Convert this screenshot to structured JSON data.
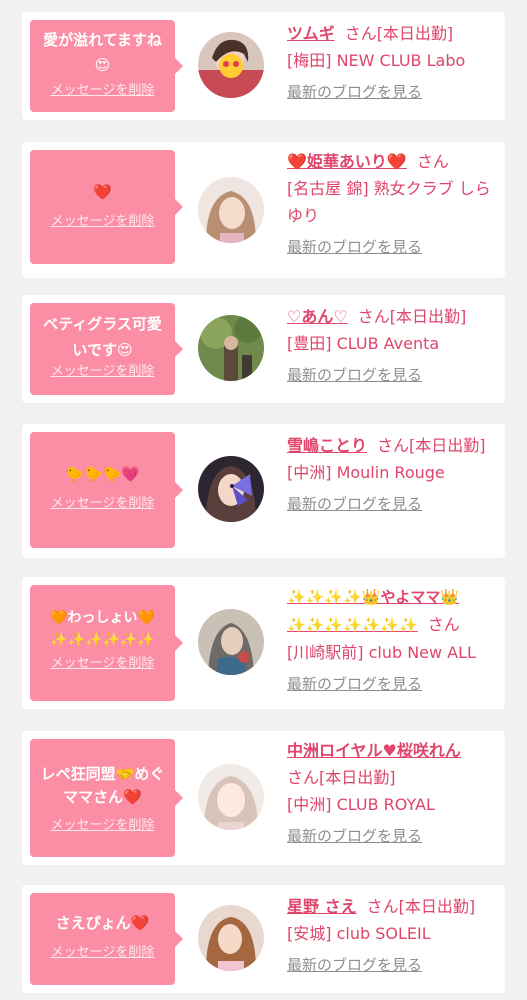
{
  "cards": [
    {
      "message": "愛が溢れてますね😍",
      "delete": "メッセージを削除",
      "name": "ツムギ",
      "suffix": "さん[本日出勤]",
      "shop": "[梅田] NEW CLUB Labo",
      "blog": "最新のブログを見る"
    },
    {
      "message": "❤️",
      "delete": "メッセージを削除",
      "name": "❤️姫華あいり❤️",
      "suffix": "さん",
      "shop": "[名古屋 錦] 熟女クラブ しらゆり",
      "blog": "最新のブログを見る"
    },
    {
      "message": "ベティグラス可愛いです😍",
      "delete": "メッセージを削除",
      "name": "♡あん♡",
      "suffix": "さん[本日出勤]",
      "shop": "[豊田] CLUB Aventa",
      "blog": "最新のブログを見る"
    },
    {
      "message": "🐤🐤🐤💗",
      "delete": "メッセージを削除",
      "name": "雪嶋ことり",
      "suffix": "さん[本日出勤]",
      "shop": "[中洲] Moulin Rouge",
      "blog": "最新のブログを見る"
    },
    {
      "message": "🧡わっしょい🧡 ✨✨✨✨✨✨",
      "delete": "メッセージを削除",
      "name": "✨✨✨✨👑やよママ👑✨✨✨✨✨✨✨",
      "suffix": "さん",
      "shop": "[川崎駅前] club New ALL",
      "blog": "最新のブログを見る"
    },
    {
      "message": "レペ狂同盟🤝めぐママさん❤️",
      "delete": "メッセージを削除",
      "name": "中洲ロイヤル♥桜咲れん",
      "suffix": "さん[本日出勤]",
      "shop": "[中洲] CLUB ROYAL",
      "blog": "最新のブログを見る"
    },
    {
      "message": "さえぴょん❤️",
      "delete": "メッセージを削除",
      "name": "星野 さえ",
      "suffix": "さん[本日出勤]",
      "shop": "[安城] club SOLEIL",
      "blog": "最新のブログを見る"
    }
  ]
}
